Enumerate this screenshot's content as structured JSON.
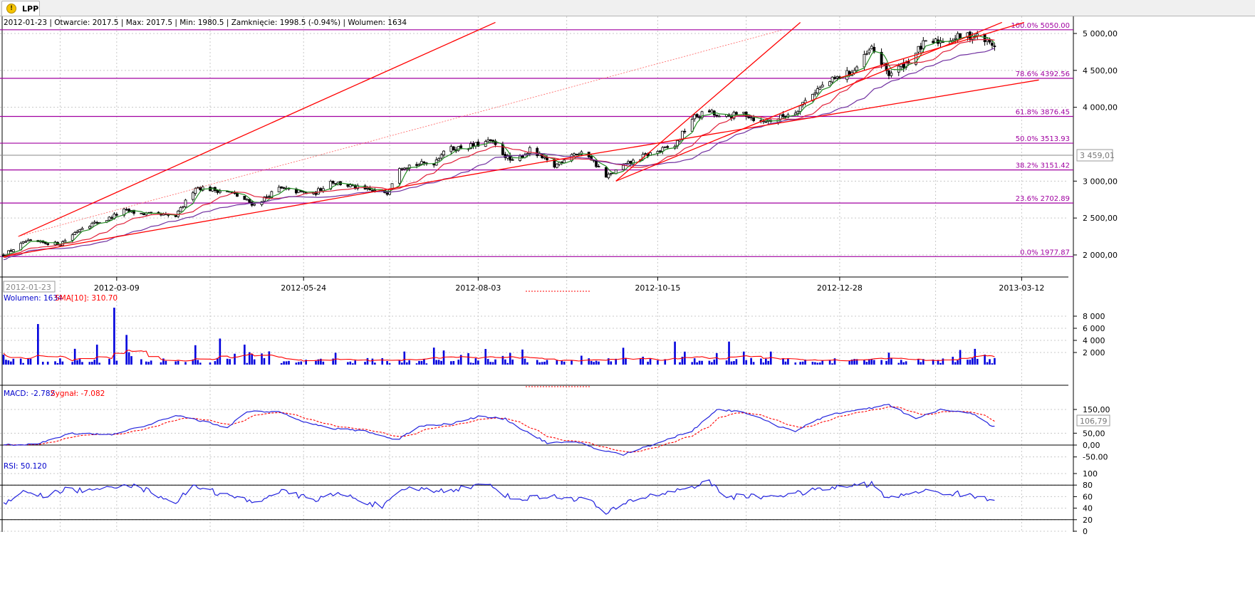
{
  "tab": {
    "label": "LPP",
    "icon": "warning-icon"
  },
  "chart_data": {
    "type": "stock-chart",
    "info_text": "2012-01-23 | Otwarcie: 2017.5 | Max: 2017.5 | Min: 1980.5 | Zamknięcie: 1998.5 (-0.94%)  | Wolumen: 1634",
    "cursor_date": "2012-01-23",
    "x_ticks": [
      "2012-03-09",
      "2012-05-24",
      "2012-08-03",
      "2012-10-15",
      "2012-12-28",
      "2013-03-12"
    ],
    "price": {
      "ylim": [
        1960,
        5150
      ],
      "tick_values": [
        5000,
        4500,
        4000,
        3000,
        2500,
        2000
      ],
      "tick_labels": [
        "5 000,00",
        "4 500,00",
        "4 000,00",
        "3 000,00",
        "2 500,00",
        "2 000,00"
      ],
      "current_label": "3 459,01",
      "fibonacci": [
        {
          "label": "100.0% 5050.00",
          "value": 5050.0
        },
        {
          "label": "78.6% 4392.56",
          "value": 4392.56
        },
        {
          "label": "61.8% 3876.45",
          "value": 3876.45
        },
        {
          "label": "50.0% 3513.93",
          "value": 3513.93
        },
        {
          "label": "38.2% 3151.42",
          "value": 3151.42
        },
        {
          "label": "23.6% 2702.89",
          "value": 2702.89
        },
        {
          "label": "0.0% 1977.87",
          "value": 1977.87
        }
      ],
      "close_anchors": [
        [
          "2012-01-23",
          1998
        ],
        [
          "2012-02-01",
          2180
        ],
        [
          "2012-02-15",
          2150
        ],
        [
          "2012-02-24",
          2380
        ],
        [
          "2012-03-05",
          2480
        ],
        [
          "2012-03-12",
          2600
        ],
        [
          "2012-03-19",
          2560
        ],
        [
          "2012-04-02",
          2520
        ],
        [
          "2012-04-10",
          2920
        ],
        [
          "2012-04-24",
          2850
        ],
        [
          "2012-05-04",
          2680
        ],
        [
          "2012-05-14",
          2900
        ],
        [
          "2012-05-28",
          2820
        ],
        [
          "2012-06-04",
          3000
        ],
        [
          "2012-06-18",
          2880
        ],
        [
          "2012-06-27",
          2850
        ],
        [
          "2012-07-02",
          3200
        ],
        [
          "2012-07-16",
          3250
        ],
        [
          "2012-07-20",
          3420
        ],
        [
          "2012-08-01",
          3480
        ],
        [
          "2012-08-08",
          3540
        ],
        [
          "2012-08-17",
          3250
        ],
        [
          "2012-08-24",
          3420
        ],
        [
          "2012-09-03",
          3200
        ],
        [
          "2012-09-10",
          3380
        ],
        [
          "2012-09-17",
          3350
        ],
        [
          "2012-09-24",
          3050
        ],
        [
          "2012-10-01",
          3200
        ],
        [
          "2012-10-10",
          3350
        ],
        [
          "2012-10-22",
          3480
        ],
        [
          "2012-10-29",
          3850
        ],
        [
          "2012-11-05",
          3950
        ],
        [
          "2012-11-09",
          3850
        ],
        [
          "2012-11-19",
          3920
        ],
        [
          "2012-11-26",
          3800
        ],
        [
          "2012-12-03",
          3850
        ],
        [
          "2012-12-10",
          3950
        ],
        [
          "2012-12-17",
          4200
        ],
        [
          "2012-12-24",
          4350
        ],
        [
          "2013-01-03",
          4500
        ],
        [
          "2013-01-10",
          4800
        ],
        [
          "2013-01-17",
          4450
        ],
        [
          "2013-01-24",
          4600
        ],
        [
          "2013-01-31",
          4850
        ],
        [
          "2013-02-07",
          4900
        ],
        [
          "2013-02-14",
          4950
        ],
        [
          "2013-02-21",
          4980
        ],
        [
          "2013-02-28",
          4850
        ]
      ],
      "moving_averages": [
        {
          "period": 5,
          "color": "#228b22"
        },
        {
          "period": 15,
          "color": "#e0203a"
        },
        {
          "period": 30,
          "color": "#7030a0"
        }
      ],
      "trend_lines": [
        {
          "from": [
            "2012-01-29",
            2250
          ],
          "to": [
            "2012-08-10",
            5150
          ],
          "color": "#ff0000",
          "dashed": false
        },
        {
          "from": [
            "2012-01-29",
            2250
          ],
          "to": [
            "2012-12-05",
            5050
          ],
          "color": "#ff6060",
          "dashed": true
        },
        {
          "from": [
            "2012-01-23",
            1977.87
          ],
          "to": [
            "2012-08-28",
            3250
          ],
          "color": "#ff0000",
          "dashed": false
        },
        {
          "from": [
            "2012-08-28",
            3250
          ],
          "to": [
            "2013-03-19",
            4370
          ],
          "color": "#ff0000",
          "dashed": false
        },
        {
          "from": [
            "2012-09-28",
            3000
          ],
          "to": [
            "2013-03-04",
            5150
          ],
          "color": "#ff0000",
          "dashed": false
        },
        {
          "from": [
            "2012-09-28",
            3000
          ],
          "to": [
            "2012-12-12",
            5150
          ],
          "color": "#ff0000",
          "dashed": false
        },
        {
          "from": [
            "2012-12-28",
            4400
          ],
          "to": [
            "2013-03-13",
            5150
          ],
          "color": "#ff0000",
          "dashed": false
        }
      ]
    },
    "volume": {
      "label_name": "Wolumen: 1634",
      "label_sma": "SMA[10]: 310.70",
      "ylim": [
        0,
        9500
      ],
      "tick_values": [
        8000,
        6000,
        4000,
        2000
      ],
      "tick_labels": [
        "8 000",
        "6 000",
        "4 000",
        "2 000"
      ],
      "bar_color": "#0000dd",
      "sma_color": "#ff0000",
      "spikes": [
        {
          "date": "2012-01-23",
          "value": 1634
        },
        {
          "date": "2012-02-06",
          "value": 6700
        },
        {
          "date": "2012-03-01",
          "value": 3300
        },
        {
          "date": "2012-03-08",
          "value": 9400
        },
        {
          "date": "2012-03-13",
          "value": 4900
        },
        {
          "date": "2012-04-10",
          "value": 3200
        },
        {
          "date": "2012-04-20",
          "value": 4300
        },
        {
          "date": "2012-04-30",
          "value": 3300
        },
        {
          "date": "2012-10-22",
          "value": 3800
        },
        {
          "date": "2012-11-13",
          "value": 3800
        },
        {
          "date": "2013-02-21",
          "value": 2600
        }
      ]
    },
    "macd": {
      "label_macd": "MACD: -2.782",
      "label_signal": "Sygnał: -7.082",
      "ylim": [
        -55,
        185
      ],
      "tick_values": [
        150,
        50,
        0,
        -50
      ],
      "tick_labels": [
        "150,00",
        "50,00",
        "0,00",
        "-50.00"
      ],
      "current_label": "106,79",
      "macd_color": "#2222dd",
      "signal_color": "#ff0000",
      "anchors": [
        [
          "2012-01-23",
          0
        ],
        [
          "2012-02-06",
          5
        ],
        [
          "2012-02-20",
          50
        ],
        [
          "2012-03-08",
          45
        ],
        [
          "2012-03-23",
          90
        ],
        [
          "2012-04-03",
          125
        ],
        [
          "2012-04-13",
          100
        ],
        [
          "2012-04-23",
          75
        ],
        [
          "2012-05-01",
          140
        ],
        [
          "2012-05-15",
          140
        ],
        [
          "2012-05-25",
          95
        ],
        [
          "2012-06-04",
          70
        ],
        [
          "2012-06-18",
          60
        ],
        [
          "2012-07-01",
          20
        ],
        [
          "2012-07-10",
          80
        ],
        [
          "2012-07-23",
          90
        ],
        [
          "2012-08-03",
          120
        ],
        [
          "2012-08-14",
          110
        ],
        [
          "2012-08-22",
          60
        ],
        [
          "2012-08-31",
          10
        ],
        [
          "2012-09-14",
          10
        ],
        [
          "2012-09-21",
          -20
        ],
        [
          "2012-10-01",
          -40
        ],
        [
          "2012-10-15",
          10
        ],
        [
          "2012-10-29",
          60
        ],
        [
          "2012-11-08",
          150
        ],
        [
          "2012-11-19",
          140
        ],
        [
          "2012-12-03",
          80
        ],
        [
          "2012-12-10",
          60
        ],
        [
          "2012-12-24",
          130
        ],
        [
          "2013-01-07",
          150
        ],
        [
          "2013-01-17",
          170
        ],
        [
          "2013-01-28",
          110
        ],
        [
          "2013-02-07",
          150
        ],
        [
          "2013-02-21",
          130
        ],
        [
          "2013-02-28",
          80
        ]
      ]
    },
    "rsi": {
      "label": "RSI: 50.120",
      "ylim": [
        0,
        100
      ],
      "tick_values": [
        100,
        80,
        60,
        40,
        20,
        0
      ],
      "tick_labels": [
        "100",
        "80",
        "60",
        "40",
        "20",
        "0"
      ],
      "lines": [
        80,
        20
      ],
      "color": "#2222dd",
      "anchors": [
        [
          "2012-01-23",
          45
        ],
        [
          "2012-02-01",
          70
        ],
        [
          "2012-02-08",
          60
        ],
        [
          "2012-02-16",
          72
        ],
        [
          "2012-03-01",
          70
        ],
        [
          "2012-03-12",
          83
        ],
        [
          "2012-03-22",
          70
        ],
        [
          "2012-04-02",
          50
        ],
        [
          "2012-04-10",
          80
        ],
        [
          "2012-04-20",
          65
        ],
        [
          "2012-05-04",
          50
        ],
        [
          "2012-05-14",
          70
        ],
        [
          "2012-05-28",
          55
        ],
        [
          "2012-06-08",
          65
        ],
        [
          "2012-06-25",
          42
        ],
        [
          "2012-07-05",
          75
        ],
        [
          "2012-07-19",
          70
        ],
        [
          "2012-08-01",
          78
        ],
        [
          "2012-08-08",
          80
        ],
        [
          "2012-08-17",
          55
        ],
        [
          "2012-08-31",
          60
        ],
        [
          "2012-09-17",
          55
        ],
        [
          "2012-09-24",
          30
        ],
        [
          "2012-10-05",
          55
        ],
        [
          "2012-10-22",
          70
        ],
        [
          "2012-11-05",
          85
        ],
        [
          "2012-11-12",
          60
        ],
        [
          "2012-11-26",
          60
        ],
        [
          "2012-12-10",
          65
        ],
        [
          "2012-12-24",
          75
        ],
        [
          "2013-01-10",
          82
        ],
        [
          "2013-01-17",
          55
        ],
        [
          "2013-01-28",
          70
        ],
        [
          "2013-02-14",
          65
        ],
        [
          "2013-02-28",
          55
        ]
      ]
    },
    "date_range": [
      "2012-01-23",
      "2013-03-31"
    ],
    "colors": {
      "fibonacci": "#a000a0",
      "grid": "#c8c8c8",
      "axis_text": "#000000"
    }
  }
}
